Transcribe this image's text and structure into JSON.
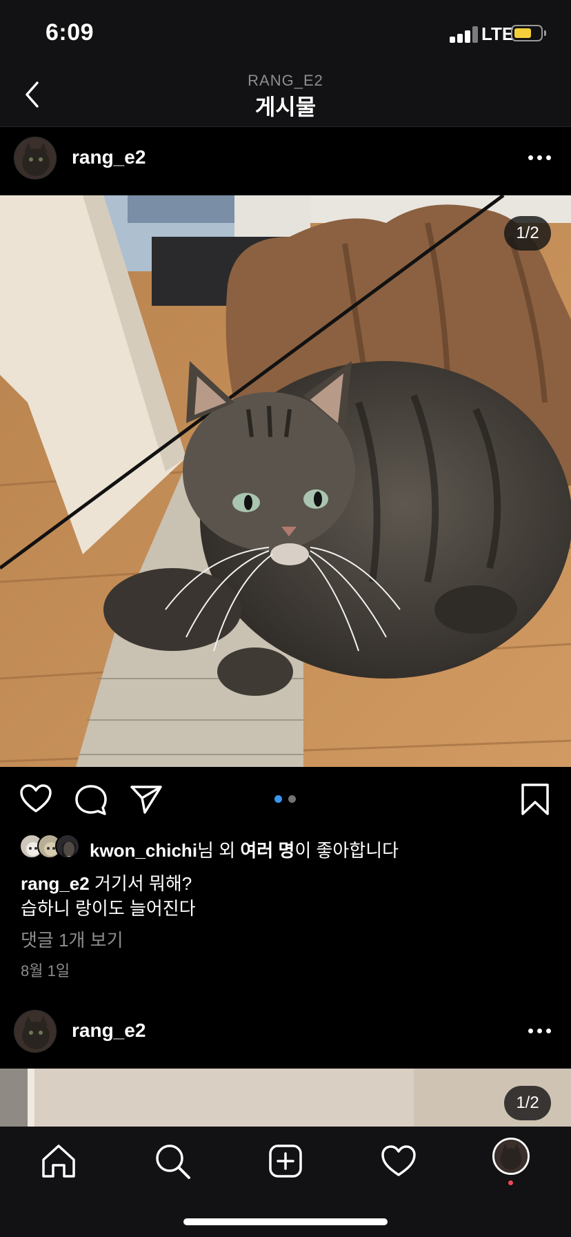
{
  "status_bar": {
    "time": "6:09",
    "network": "LTE",
    "battery_color": "#f4cf3a"
  },
  "nav": {
    "subtitle": "RANG_E2",
    "title": "게시물",
    "back_icon": "chevron-left-icon"
  },
  "posts": [
    {
      "username": "rang_e2",
      "photo_counter": "1/2",
      "more_icon": "ellipsis-icon"
    },
    {
      "username": "rang_e2",
      "photo_counter": "1/2",
      "more_icon": "ellipsis-icon"
    }
  ],
  "actions": {
    "like_icon": "heart-icon",
    "comment_icon": "comment-bubble-icon",
    "share_icon": "paper-plane-icon",
    "save_icon": "bookmark-icon",
    "carousel_active_color": "#3897f0",
    "carousel_inactive_color": "#737373"
  },
  "likes": {
    "liker": "kwon_chichi",
    "suffix_1": "님 외 ",
    "others": "여러 명",
    "suffix_2": "이 좋아합니다"
  },
  "caption": {
    "username": "rang_e2",
    "line1": " 거기서 뭐해?",
    "line2": "습하니 랑이도 늘어진다"
  },
  "view_comments": "댓글 1개 보기",
  "date": "8월 1일",
  "tab_bar": {
    "tabs": [
      "home-icon",
      "search-icon",
      "new-post-icon",
      "activity-heart-icon",
      "profile-avatar"
    ],
    "notification_dot_color": "#ed4956"
  }
}
